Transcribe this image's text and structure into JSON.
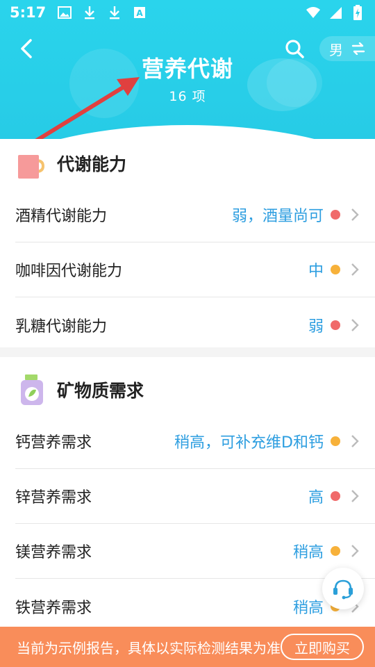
{
  "status_bar": {
    "time": "5:17",
    "left_icons": [
      "image-icon",
      "download-icon",
      "download-icon",
      "font-a-icon"
    ],
    "right_icons": [
      "wifi-icon",
      "signal-icon",
      "battery-charging-icon"
    ]
  },
  "header": {
    "title": "营养代谢",
    "subtitle": "16 项",
    "gender_label": "男",
    "gender_switch_icon": "swap-icon",
    "bg_color": "#28cde7"
  },
  "sections": [
    {
      "title": "代谢能力",
      "icon": "cup-icon",
      "items": [
        {
          "label": "酒精代谢能力",
          "value": "弱，酒量尚可",
          "status": "red"
        },
        {
          "label": "咖啡因代谢能力",
          "value": "中",
          "status": "orange"
        },
        {
          "label": "乳糖代谢能力",
          "value": "弱",
          "status": "red"
        }
      ]
    },
    {
      "title": "矿物质需求",
      "icon": "supplement-jar-icon",
      "items": [
        {
          "label": "钙营养需求",
          "value": "稍高，可补充维D和钙",
          "status": "orange"
        },
        {
          "label": "锌营养需求",
          "value": "高",
          "status": "red"
        },
        {
          "label": "镁营养需求",
          "value": "稍高",
          "status": "orange"
        },
        {
          "label": "铁营养需求",
          "value": "稍高",
          "status": "orange"
        }
      ]
    }
  ],
  "colors": {
    "red": "#f06a6a",
    "orange": "#f7b13a",
    "value_blue": "#2d9ee0",
    "banner": "#f98d5a"
  },
  "bottom_banner": {
    "text": "当前为示例报告，具体以实际检测结果为准",
    "button_label": "立即购买"
  },
  "support_icon": "headset-icon"
}
